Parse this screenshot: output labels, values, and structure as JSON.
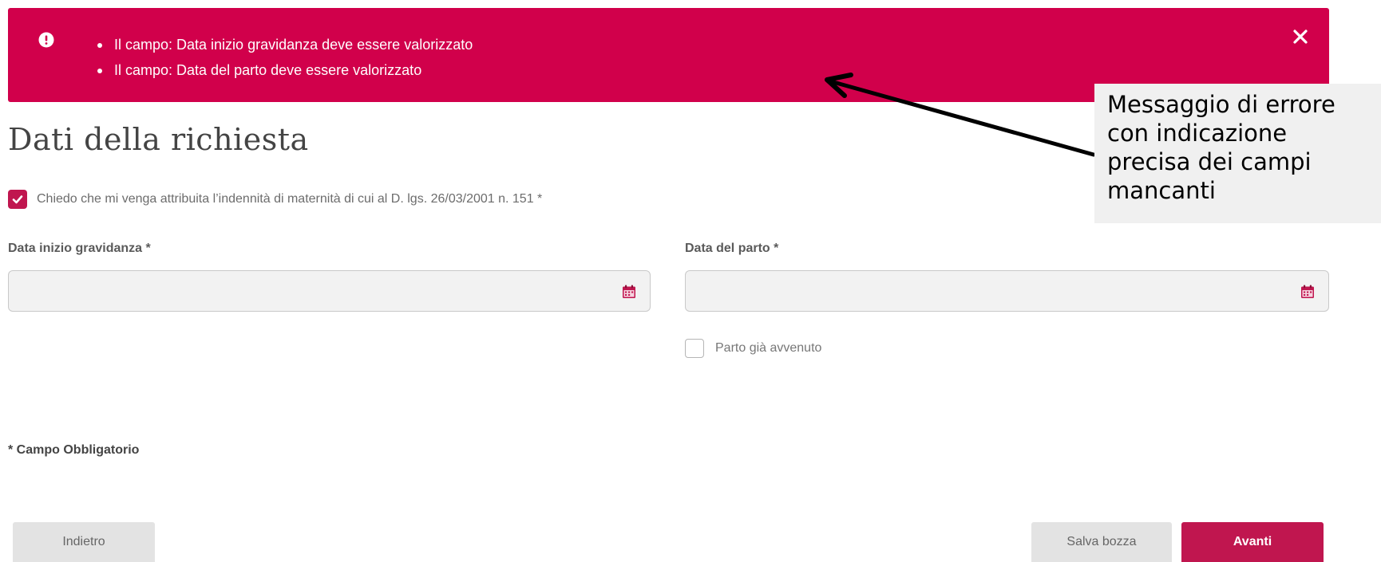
{
  "error_banner": {
    "messages": [
      "Il campo: Data inizio gravidanza deve essere valorizzato",
      "Il campo: Data del parto deve essere valorizzato"
    ],
    "icon": "alert-circle-icon",
    "close_icon": "close-icon",
    "background_color": "#d1004b"
  },
  "page": {
    "title": "Dati della richiesta"
  },
  "consent": {
    "label": "Chiedo che mi venga attribuita l’indennità di maternità di cui al D. lgs. 26/03/2001 n. 151 *",
    "checked": true
  },
  "fields": {
    "pregnancy_start": {
      "label": "Data inizio gravidanza *",
      "value": "",
      "icon": "calendar-icon"
    },
    "delivery_date": {
      "label": "Data del parto *",
      "value": "",
      "icon": "calendar-icon"
    }
  },
  "delivery_done": {
    "label": "Parto già avvenuto",
    "checked": false
  },
  "required_note": "* Campo Obbligatorio",
  "buttons": {
    "back": "Indietro",
    "save_draft": "Salva bozza",
    "next": "Avanti"
  },
  "annotation": {
    "text": "Messaggio di errore con indicazione precisa dei campi mancanti"
  },
  "colors": {
    "accent": "#c0164f",
    "error": "#d1004b"
  }
}
